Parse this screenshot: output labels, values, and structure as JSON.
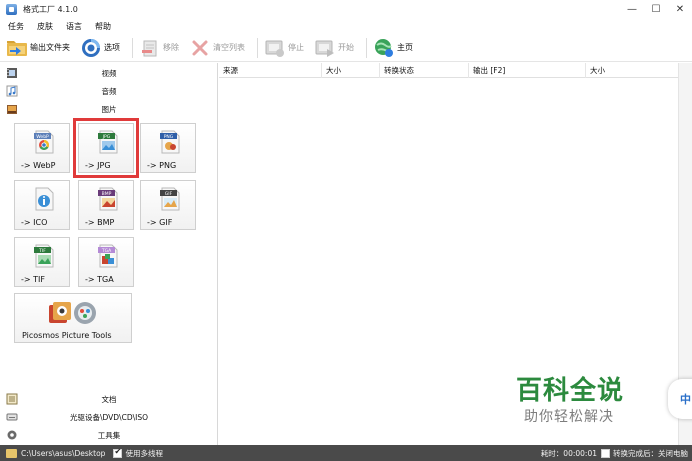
{
  "window": {
    "title": "格式工厂 4.1.0",
    "minimize_glyph": "—",
    "maximize_glyph": "☐",
    "close_glyph": "✕"
  },
  "menu": [
    "任务",
    "皮肤",
    "语言",
    "帮助"
  ],
  "toolbar": {
    "output_folder": "输出文件夹",
    "options": "选项",
    "remove": "移除",
    "clear_list": "清空列表",
    "stop": "停止",
    "start": "开始",
    "home": "主页"
  },
  "categories": {
    "video": "视频",
    "audio": "音频",
    "picture": "图片",
    "document": "文档",
    "disc": "光驱设备\\DVD\\CD\\ISO",
    "tools": "工具集"
  },
  "tiles": {
    "webp": {
      "label": "-> WebP",
      "badge": "WebP"
    },
    "jpg": {
      "label": "-> JPG",
      "badge": "JPG"
    },
    "png": {
      "label": "-> PNG",
      "badge": "PNG"
    },
    "ico": {
      "label": "-> ICO"
    },
    "bmp": {
      "label": "-> BMP",
      "badge": "BMP"
    },
    "gif": {
      "label": "-> GIF",
      "badge": "GIF"
    },
    "tif": {
      "label": "-> TIF",
      "badge": "TIF"
    },
    "tga": {
      "label": "-> TGA",
      "badge": "TGA"
    },
    "picosmos": {
      "label": "Picosmos Picture Tools"
    }
  },
  "list": {
    "columns": [
      "来源",
      "大小",
      "转换状态",
      "输出 [F2]",
      "大小"
    ]
  },
  "watermark": {
    "title": "百科全说",
    "subtitle": "助你轻松解决",
    "side": "中"
  },
  "status": {
    "output_path": "C:\\Users\\asus\\Desktop",
    "multithread_label": "使用多线程",
    "multithread_checked": true,
    "elapsed": "耗时：00:00:01",
    "after_done_label": "转换完成后：关闭电脑",
    "after_done_checked": false
  },
  "colors": {
    "selection_outline": "#e03a3a",
    "statusbar_bg": "#4a4a4a",
    "watermark_green": "#2c8a3e"
  }
}
